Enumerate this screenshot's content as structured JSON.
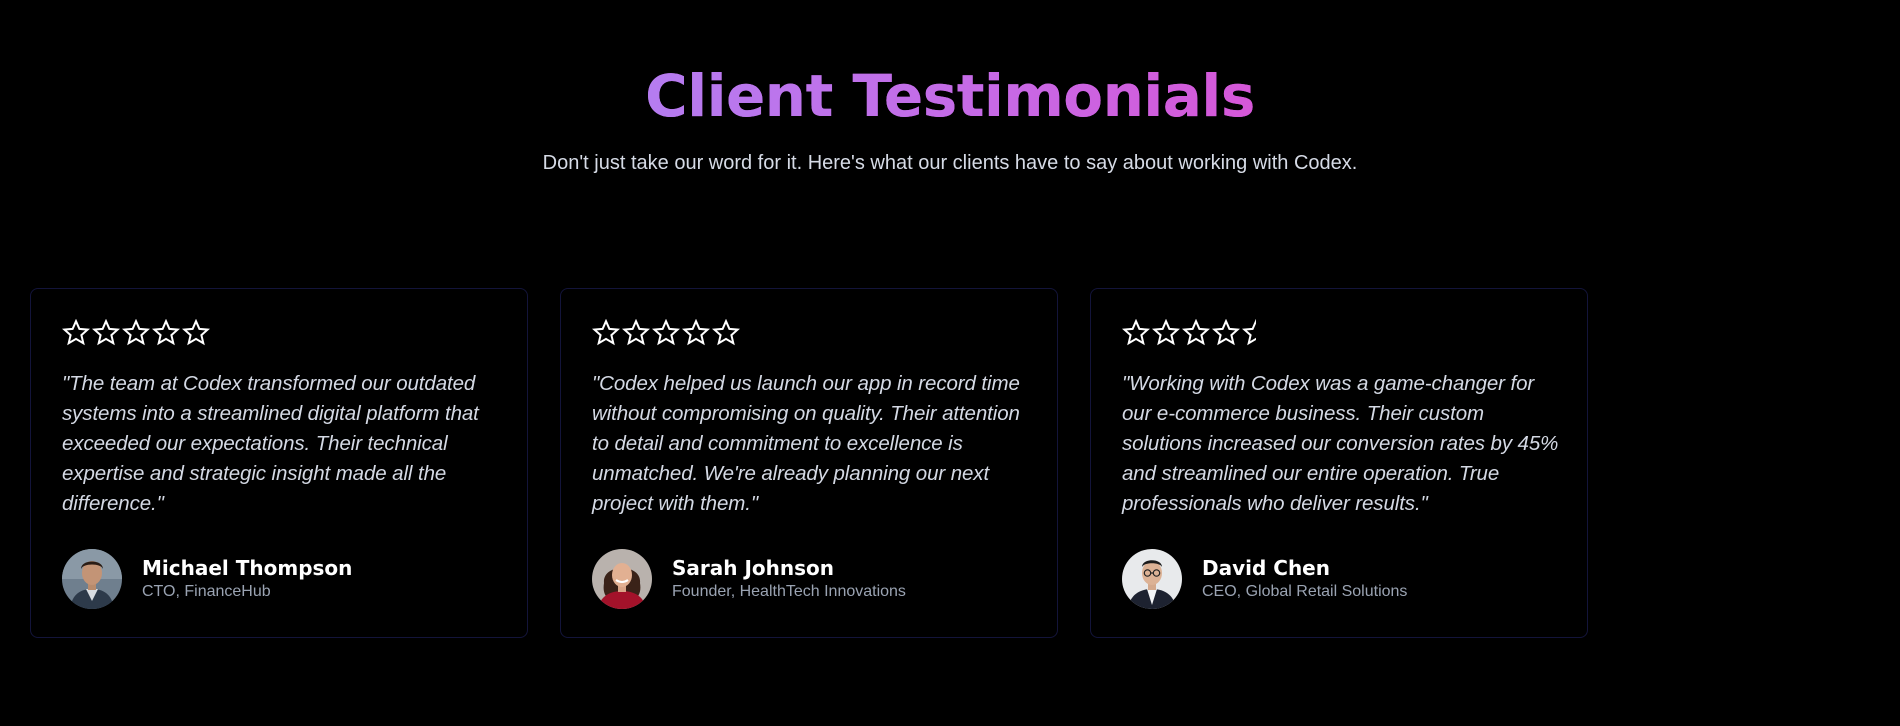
{
  "section": {
    "title": "Client Testimonials",
    "subtitle": "Don't just take our word for it. Here's what our clients have to say about working with Codex."
  },
  "colors": {
    "background": "#000000",
    "title_gradient_start": "#b57cf0",
    "title_gradient_end": "#d657d8",
    "card_border": "#13143a",
    "quote_text": "#d4d9e4",
    "role_text": "#9aa3b2",
    "star_stroke": "#ffffff"
  },
  "testimonials": [
    {
      "rating": 5,
      "rating_max": 5,
      "quote": "\"The team at Codex transformed our outdated systems into a streamlined digital platform that exceeded our expectations. Their technical expertise and strategic insight made all the difference.\"",
      "name": "Michael Thompson",
      "role": "CTO, FinanceHub",
      "avatar_icon": "avatar-man-icon"
    },
    {
      "rating": 5,
      "rating_max": 5,
      "quote": "\"Codex helped us launch our app in record time without compromising on quality. Their attention to detail and commitment to excellence is unmatched. We're already planning our next project with them.\"",
      "name": "Sarah Johnson",
      "role": "Founder, HealthTech Innovations",
      "avatar_icon": "avatar-woman-icon"
    },
    {
      "rating": 4.5,
      "rating_max": 5,
      "quote": "\"Working with Codex was a game-changer for our e-commerce business. Their custom solutions increased our conversion rates by 45% and streamlined our entire operation. True professionals who deliver results.\"",
      "name": "David Chen",
      "role": "CEO, Global Retail Solutions",
      "avatar_icon": "avatar-man-glasses-icon"
    }
  ]
}
